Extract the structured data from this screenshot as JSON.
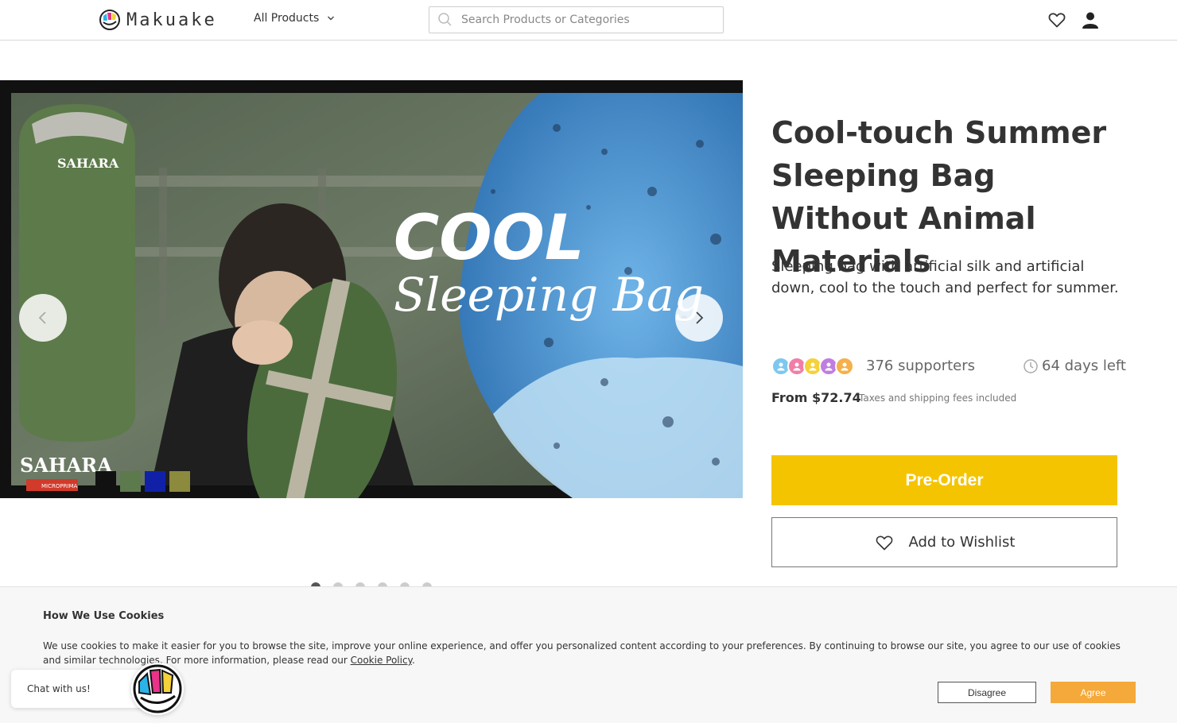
{
  "header": {
    "logo_text": "Makuake",
    "all_products_label": "All Products",
    "search_placeholder": "Search Products or Categories",
    "icons": [
      "heart-icon",
      "user-icon",
      "search-icon",
      "chevron-down-icon"
    ]
  },
  "carousel": {
    "banner_line1": "COOL",
    "banner_line2": "Sleeping Bag",
    "brand": "SAHARA",
    "brand_sub": "MICROPRIMA",
    "color_swatches": [
      "#111111",
      "#5c7a4c",
      "#1021a8",
      "#8c8a3c"
    ],
    "slide_count": 6,
    "active_slide": 1
  },
  "product": {
    "title": "Cool-touch Summer Sleeping Bag Without Animal Materials",
    "description": "Sleeping bag with artificial silk and artificial down, cool to the touch and perfect for summer.",
    "supporters": "376 supporters",
    "days_left": "64 days left",
    "price": "From $72.74",
    "tax_note": "Taxes and shipping fees included",
    "preorder_label": "Pre-Order",
    "wishlist_label": "Add to Wishlist",
    "avatar_colors": [
      "#7ec8f0",
      "#f07fa8",
      "#f5d13a",
      "#c07ee0",
      "#f5b04a"
    ]
  },
  "cookie": {
    "title": "How We Use Cookies",
    "text": "We use cookies to make it easier for you to browse the site, improve your online experience, and offer you personalized content according to your preferences. By continuing to browse our site, you agree to our use of cookies and similar technologies. For more information, please read our ",
    "link": "Cookie Policy",
    "text_end": ".",
    "disagree_label": "Disagree",
    "agree_label": "Agree"
  },
  "chat": {
    "label": "Chat with us!"
  },
  "colors": {
    "preorder": "#f5c400",
    "agree": "#f4a93a"
  }
}
